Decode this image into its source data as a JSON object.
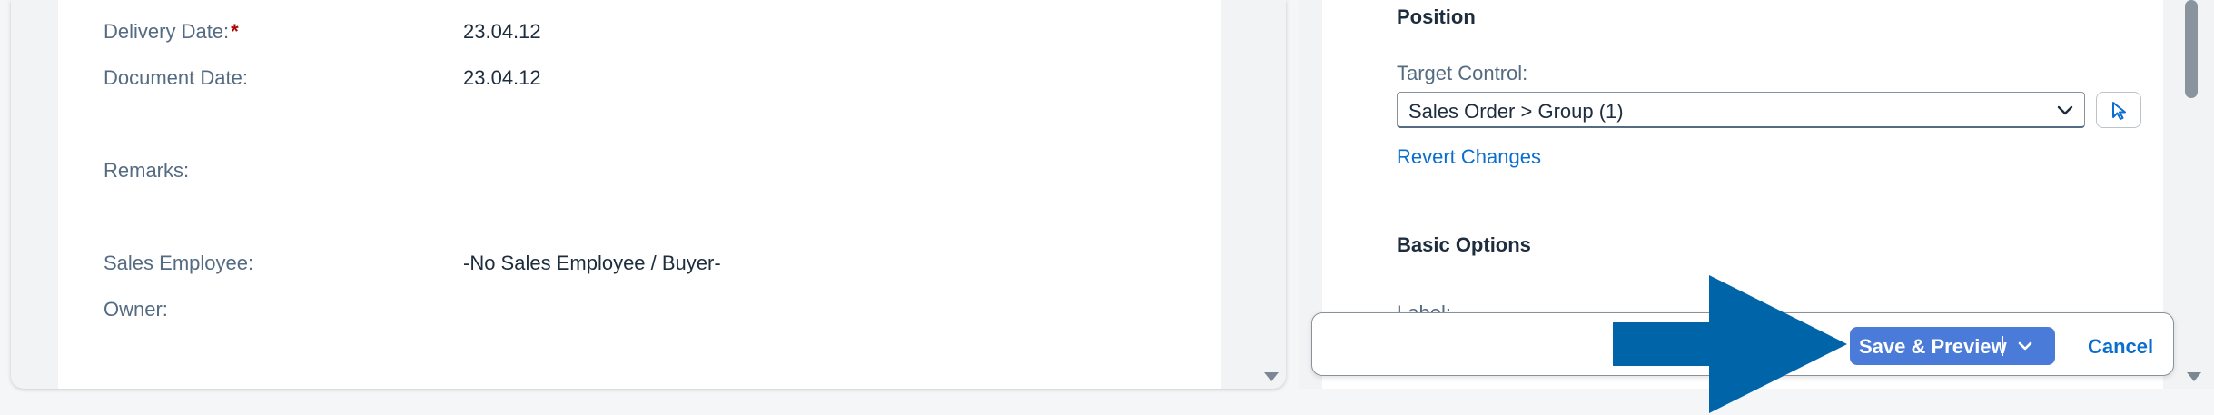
{
  "form": {
    "fields": [
      {
        "label": "Delivery Date:",
        "required_mark": "*",
        "value": "23.04.12"
      },
      {
        "label": "Document Date:",
        "value": "23.04.12"
      },
      {
        "label": "Remarks:",
        "value": ""
      },
      {
        "label": "Sales Employee:",
        "value": "-No Sales Employee / Buyer-"
      },
      {
        "label": "Owner:",
        "value": ""
      }
    ]
  },
  "settings": {
    "position_title": "Position",
    "target_control_label": "Target Control:",
    "target_control_value": "Sales Order > Group (1)",
    "revert_label": "Revert Changes",
    "basic_options_title": "Basic Options",
    "label_field_hint": "Label:"
  },
  "footer": {
    "save_preview_label": "Save & Preview",
    "cancel_label": "Cancel"
  },
  "colors": {
    "accent": "#0a6ed1",
    "primary_button": "#4a7bd8",
    "annotation_arrow": "#0064a8",
    "required_mark": "#aa0808"
  },
  "icons": [
    "chevron-down-icon",
    "cursor-pointer-icon",
    "scroll-down-icon",
    "arrow-right-annotation-icon"
  ]
}
